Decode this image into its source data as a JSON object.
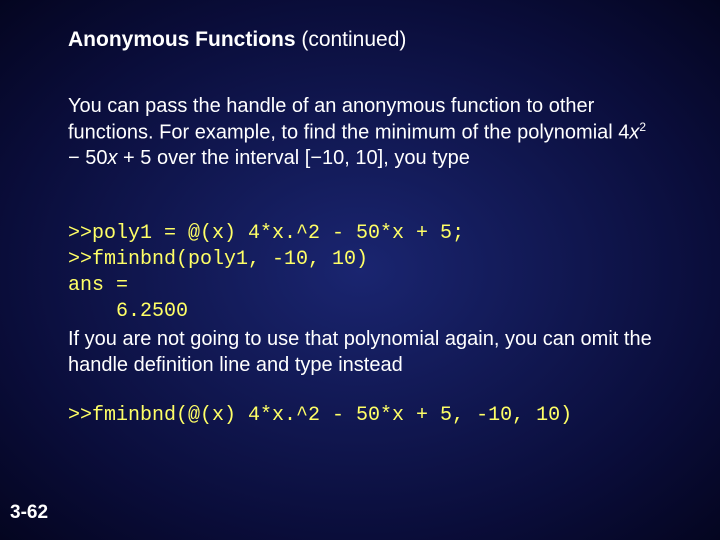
{
  "title": {
    "main": "Anonymous Functions",
    "suffix": " (continued)"
  },
  "para1": {
    "t1": "You can pass the handle of an anonymous function to other functions. For example, to find the minimum of the polynomial 4",
    "x": "x",
    "t2": " − 50",
    "t3": " + 5 over the interval [−10, 10], you type"
  },
  "code1": {
    "l1": ">>poly1 = @(x) 4*x.^2 - 50*x + 5;",
    "l2": ">>fminbnd(poly1, -10, 10)",
    "l3": "ans =",
    "l4": "6.2500"
  },
  "para2": "If you are not going to use that polynomial again, you can omit the handle definition line and type instead",
  "code2": ">>fminbnd(@(x) 4*x.^2 - 50*x + 5, -10, 10)",
  "pagenum": "3-62"
}
